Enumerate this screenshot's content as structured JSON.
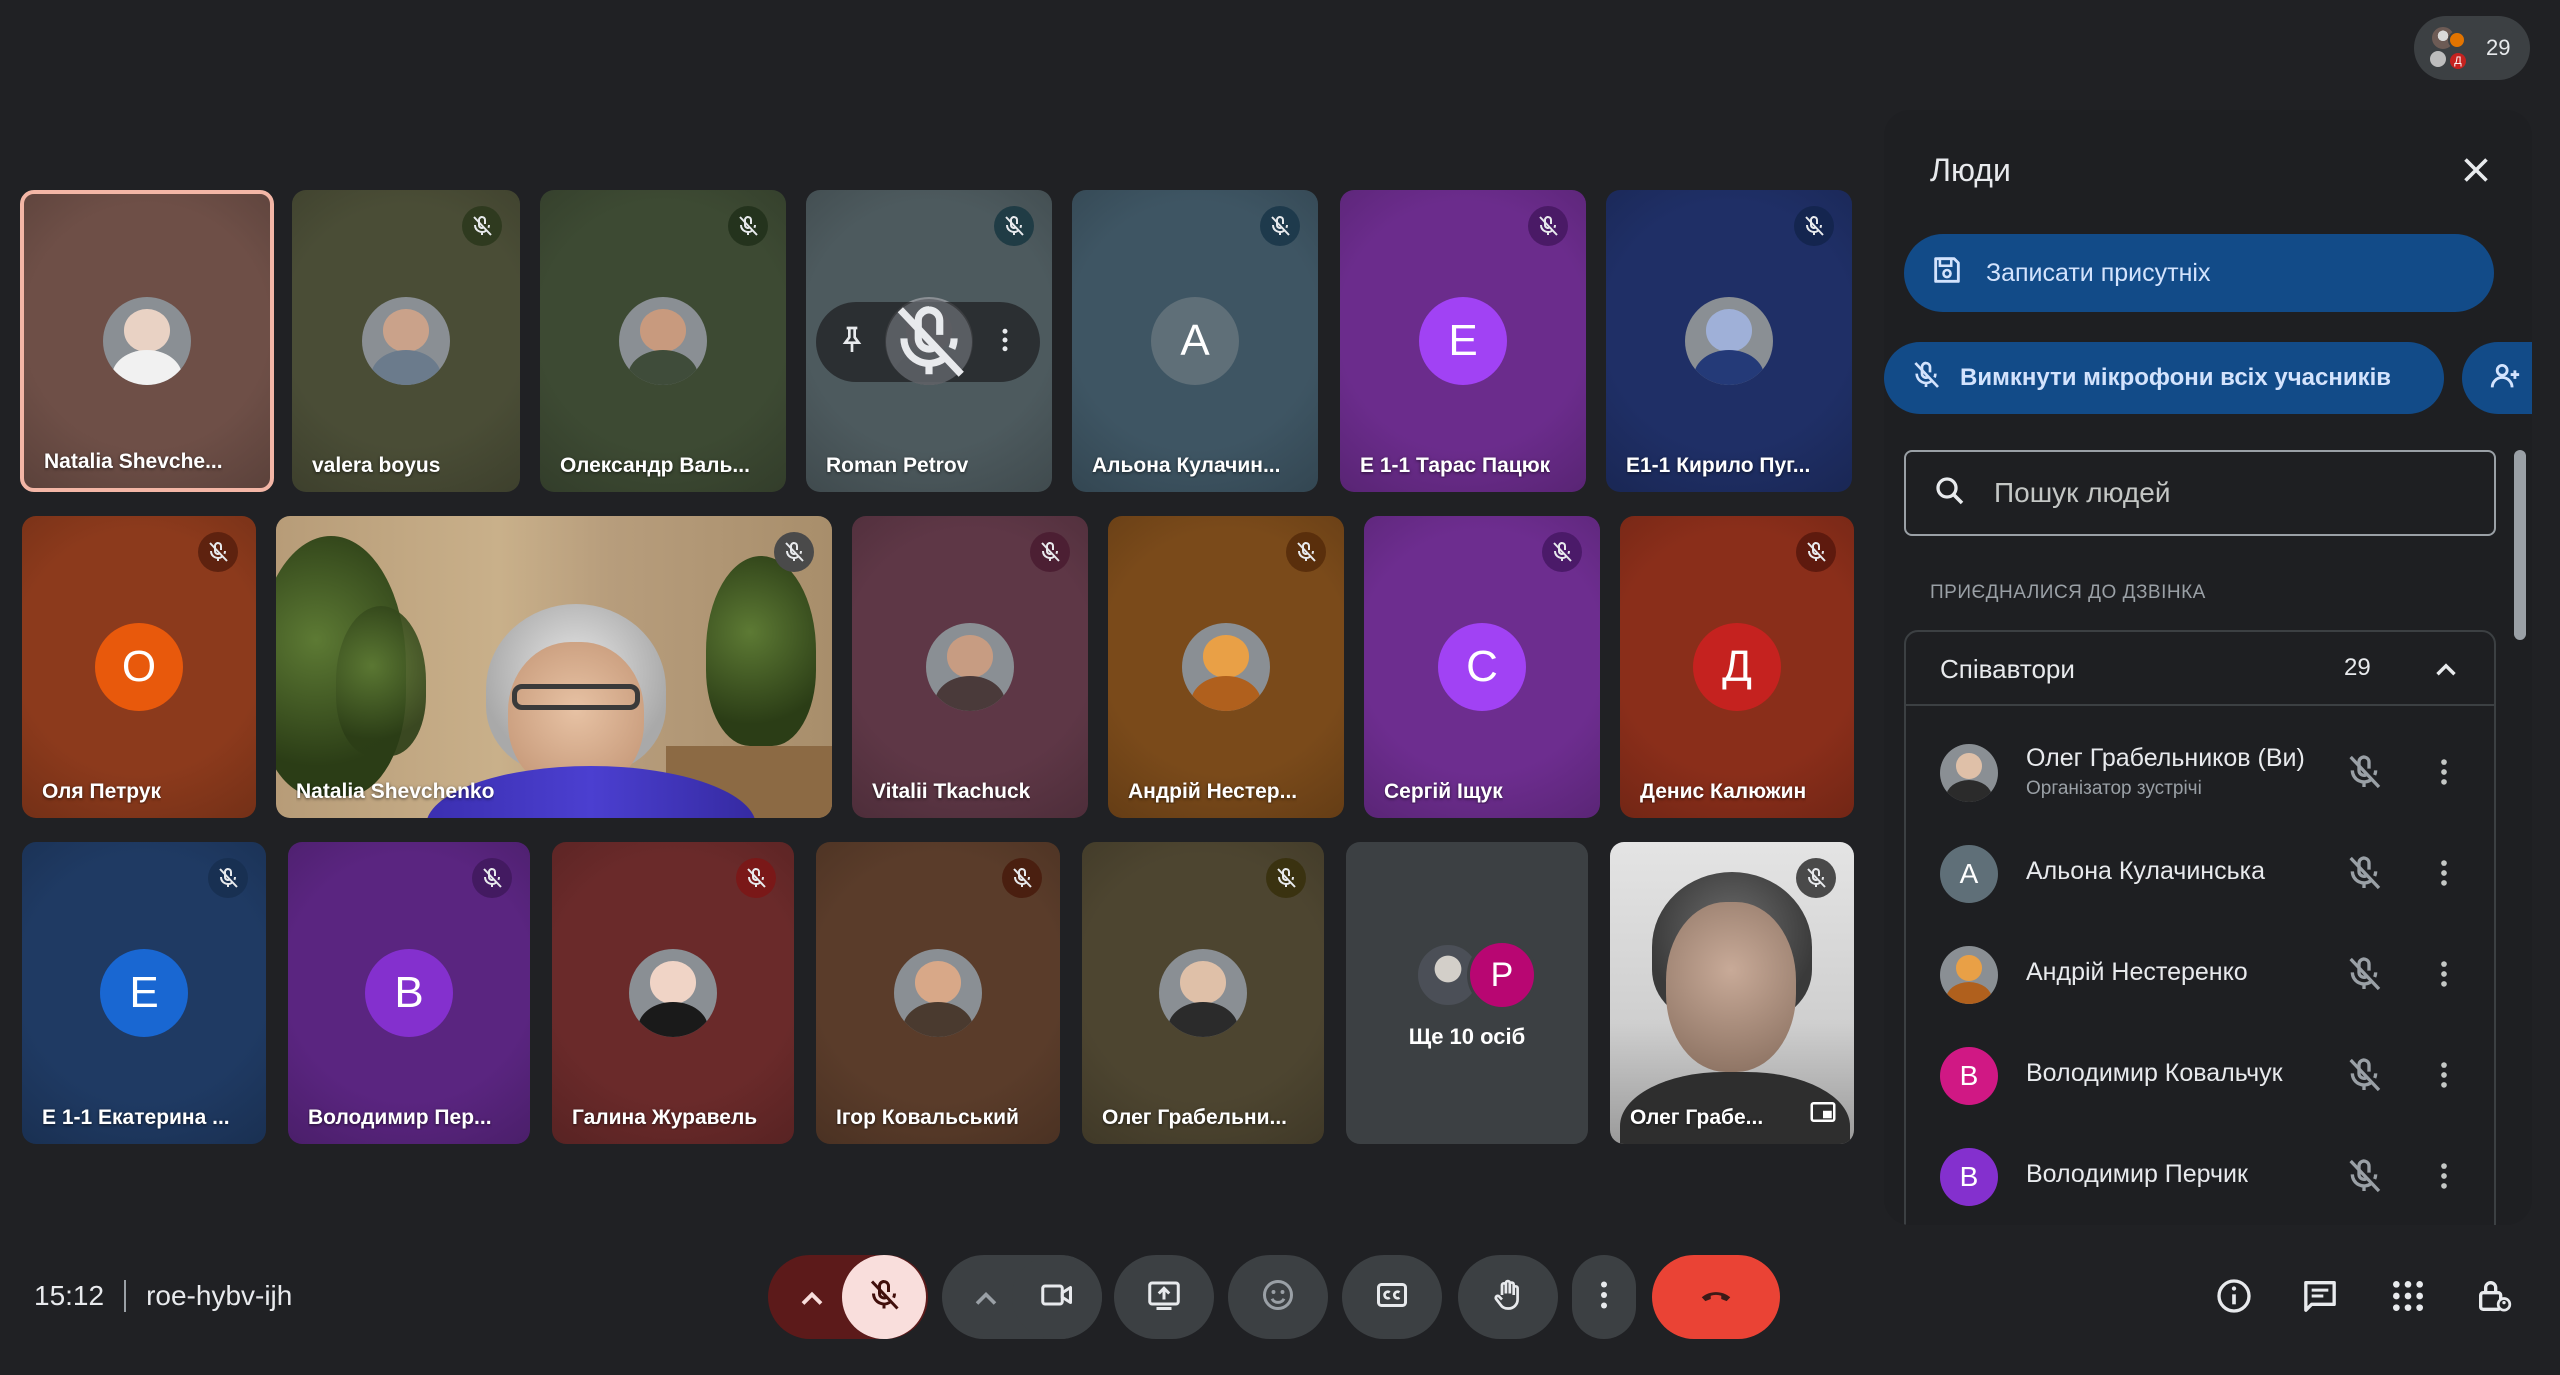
{
  "participant_count": "29",
  "tiles": [
    {
      "name": "Natalia Shevche...",
      "avatar_type": "photo",
      "bg": "#6e4f47"
    },
    {
      "name": "valera boyus",
      "avatar_type": "photo",
      "bg": "#4a4d36",
      "mute_bg": "#2f3a1f"
    },
    {
      "name": "Олександр Валь...",
      "avatar_type": "photo",
      "bg": "#3d4a33",
      "mute_bg": "#24331d"
    },
    {
      "name": "Roman Petrov",
      "avatar_type": "photo",
      "bg": "#4d5a5e",
      "mute_bg": "#203c45"
    },
    {
      "name": "Альона Кулачин...",
      "avatar_type": "letter",
      "letter": "А",
      "bg": "#3e5563",
      "mute_bg": "#1e3a4c",
      "avatar_color": "#5f6f78"
    },
    {
      "name": "Е 1-1 Тарас Пацюк",
      "avatar_type": "letter",
      "letter": "Е",
      "bg": "#6b2c8c",
      "mute_bg": "#4a1a66",
      "avatar_color": "#a142f4"
    },
    {
      "name": "Е1-1 Кирило Пуг...",
      "avatar_type": "photo",
      "bg": "#1f2f66",
      "mute_bg": "#14254f"
    },
    {
      "name": "Оля Петрук",
      "avatar_type": "letter",
      "letter": "О",
      "bg": "#8c3a1c",
      "mute_bg": "#5e220f",
      "avatar_color": "#e8590c"
    },
    {
      "name": "Natalia Shevchenko",
      "avatar_type": "video",
      "mute_bg": "#4a4a4a"
    },
    {
      "name": "Vitalii Tkachuck",
      "avatar_type": "photo",
      "bg": "#5e3746",
      "mute_bg": "#4c1f33"
    },
    {
      "name": "Андрій Нестер...",
      "avatar_type": "photo",
      "bg": "#7a4a1a",
      "mute_bg": "#5a2f0c"
    },
    {
      "name": "Сергій Іщук",
      "avatar_type": "letter",
      "letter": "С",
      "bg": "#6d2d8f",
      "mute_bg": "#4b1a69",
      "avatar_color": "#a142f4"
    },
    {
      "name": "Денис Калюжин",
      "avatar_type": "letter",
      "letter": "Д",
      "bg": "#8a2e1a",
      "mute_bg": "#5e1a0e",
      "avatar_color": "#c5221f"
    },
    {
      "name": "Е 1-1 Екатерина ...",
      "avatar_type": "letter",
      "letter": "Е",
      "bg": "#1f3a63",
      "mute_bg": "#183052",
      "avatar_color": "#1967d2"
    },
    {
      "name": "Володимир Пер...",
      "avatar_type": "letter",
      "letter": "В",
      "bg": "#5a2580",
      "mute_bg": "#431a61",
      "avatar_color": "#8430ce"
    },
    {
      "name": "Галина Журавель",
      "avatar_type": "photo",
      "bg": "#6a2a2a",
      "mute_bg": "#7a1818"
    },
    {
      "name": "Ігор Ковальський",
      "avatar_type": "photo",
      "bg": "#5a3c2a",
      "mute_bg": "#4a1f10"
    },
    {
      "name": "Олег Грабельни...",
      "avatar_type": "photo",
      "bg": "#4d4530",
      "mute_bg": "#3a3210"
    },
    {
      "name": "Ще 10 осіб",
      "avatar_type": "more",
      "bg": "#3c4043",
      "letter": "Р"
    },
    {
      "name": "Олег Грабе...",
      "avatar_type": "video2",
      "mute_bg": "#4a4a4a"
    }
  ],
  "bottom": {
    "time": "15:12",
    "meeting_code": "roe-hybv-ijh"
  },
  "panel": {
    "title": "Люди",
    "record_button": "Записати присутніх",
    "mute_all_button": "Вимкнути мікрофони всіх учасників",
    "search_placeholder": "Пошук людей",
    "section_label": "ПРИЄДНАЛИСЯ ДО ДЗВІНКА",
    "group_name": "Співавтори",
    "group_count": "29",
    "people": [
      {
        "name": "Олег Грабельников (Ви)",
        "subtitle": "Організатор зустрічі",
        "avatar_type": "photo"
      },
      {
        "name": "Альона Кулачинська",
        "avatar_type": "letter",
        "letter": "А",
        "avatar_color": "#5f6f78"
      },
      {
        "name": "Андрій Нестеренко",
        "avatar_type": "photo"
      },
      {
        "name": "Володимир Ковальчук",
        "avatar_type": "letter",
        "letter": "В",
        "avatar_color": "#d01884"
      },
      {
        "name": "Володимир Перчик",
        "avatar_type": "letter",
        "letter": "В",
        "avatar_color": "#8430ce"
      }
    ]
  },
  "colors": {
    "end_call": "#ea4335",
    "mic_off_bg": "#f9dedc",
    "accent_blue": "#124b88"
  }
}
